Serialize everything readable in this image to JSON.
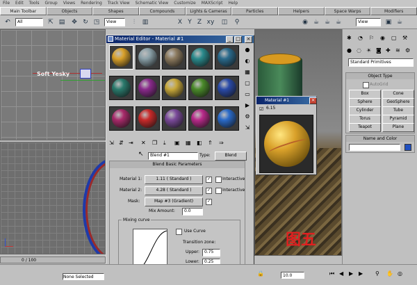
{
  "menu": [
    "File",
    "Edit",
    "Tools",
    "Group",
    "Views",
    "Rendering",
    "Track View",
    "Schematic View",
    "Customize",
    "MAXScript",
    "Help"
  ],
  "tabs": [
    "Main Toolbar",
    "Objects",
    "Shapes",
    "Compounds",
    "Lights & Cameras",
    "Particles",
    "Helpers",
    "Space Warps",
    "Modifiers"
  ],
  "toolbar": {
    "selection_filter": "All",
    "coord_system": "View"
  },
  "viewport_left": {
    "label": "Soft Yesky",
    "frame_counter": "0 / 100"
  },
  "material_editor": {
    "title": "Material Editor - Material #1",
    "material_name": "Blend #1",
    "type_label": "Type:",
    "type_value": "Blend",
    "rollout_title": "Blend Basic Parameters",
    "material1_label": "Material 1:",
    "material1_value": "1.11  ( Standard )",
    "material2_label": "Material 2:",
    "material2_value": "4.28  ( Standard )",
    "mask_label": "Mask:",
    "mask_value": "Map #3 (Gradient)",
    "interactive_label": "Interactive",
    "mix_amount_label": "Mix Amount:",
    "mix_amount_value": "0.0",
    "mixing_curve_label": "Mixing curve",
    "use_curve_label": "Use Curve",
    "transition_zone_label": "Transition zone:",
    "upper_label": "Upper:",
    "upper_value": "0.75",
    "lower_label": "Lower:",
    "lower_value": "0.25"
  },
  "sample_colors": [
    "#d9a12a",
    "#8aa0a8",
    "#8c7a5e",
    "#2a8a8c",
    "#2a6a8c",
    "#2a7a6c",
    "#8a2a8c",
    "#c8a83a",
    "#4a8a2a",
    "#2a4aa8",
    "#a82a6a",
    "#c82a2a",
    "#7a4a9a",
    "#b82a8a",
    "#2a6ac8"
  ],
  "material_preview": {
    "title": "Material #1",
    "badge": "6.15"
  },
  "command_panel": {
    "dropdown": "Standard Primitives",
    "object_type_title": "Object Type",
    "autogrid_label": "AutoGrid",
    "buttons": [
      "Box",
      "Cone",
      "Sphere",
      "GeoSphere",
      "Cylinder",
      "Tube",
      "Torus",
      "Pyramid",
      "Teapot",
      "Plane"
    ],
    "name_color_title": "Name and Color"
  },
  "overlay_text": "图五",
  "status": {
    "selection": "None Selected",
    "frame": "10.0"
  }
}
